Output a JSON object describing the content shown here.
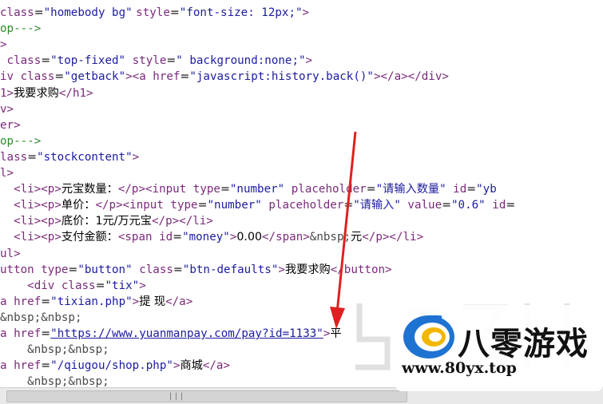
{
  "editor": {
    "lines": [
      [
        {
          "t": "class",
          "c": "attr"
        },
        {
          "t": "=",
          "c": "txt"
        },
        {
          "t": "\"homebody bg\"",
          "c": "str"
        },
        {
          "t": " ",
          "c": "txt"
        },
        {
          "t": "style",
          "c": "attr"
        },
        {
          "t": "=",
          "c": "txt"
        },
        {
          "t": "\"font-size: 12px;\"",
          "c": "str"
        },
        {
          "t": ">",
          "c": "tag"
        }
      ],
      [
        {
          "t": "op--->",
          "c": "cmt"
        }
      ],
      [
        {
          "t": ">",
          "c": "tag"
        }
      ],
      [
        {
          "t": " class",
          "c": "attr"
        },
        {
          "t": "=",
          "c": "txt"
        },
        {
          "t": "\"top-fixed\"",
          "c": "str"
        },
        {
          "t": " style",
          "c": "attr"
        },
        {
          "t": "=",
          "c": "txt"
        },
        {
          "t": "\" background:none;\"",
          "c": "str"
        },
        {
          "t": ">",
          "c": "tag"
        }
      ],
      [
        {
          "t": "iv class",
          "c": "tag"
        },
        {
          "t": "=",
          "c": "txt"
        },
        {
          "t": "\"getback\"",
          "c": "str"
        },
        {
          "t": "><a href",
          "c": "tag"
        },
        {
          "t": "=",
          "c": "txt"
        },
        {
          "t": "\"javascript:history.back()\"",
          "c": "str"
        },
        {
          "t": "></a></div>",
          "c": "tag"
        }
      ],
      [
        {
          "t": "1>",
          "c": "tag"
        },
        {
          "t": "我要求购",
          "c": "txt"
        },
        {
          "t": "</h1>",
          "c": "tag"
        }
      ],
      [
        {
          "t": "v>",
          "c": "tag"
        }
      ],
      [
        {
          "t": "er>",
          "c": "tag"
        }
      ],
      [
        {
          "t": "op--->",
          "c": "cmt"
        }
      ],
      [
        {
          "t": "lass",
          "c": "attr"
        },
        {
          "t": "=",
          "c": "txt"
        },
        {
          "t": "\"stockcontent\"",
          "c": "str"
        },
        {
          "t": ">",
          "c": "tag"
        }
      ],
      [
        {
          "t": "l>",
          "c": "tag"
        }
      ],
      [
        {
          "t": "  <li><p>",
          "c": "tag"
        },
        {
          "t": "元宝数量：",
          "c": "txt"
        },
        {
          "t": "</p><input ",
          "c": "tag"
        },
        {
          "t": "type",
          "c": "attr"
        },
        {
          "t": "=",
          "c": "txt"
        },
        {
          "t": "\"number\"",
          "c": "str"
        },
        {
          "t": " placeholder",
          "c": "attr"
        },
        {
          "t": "=",
          "c": "txt"
        },
        {
          "t": "\"请输入数量\"",
          "c": "str"
        },
        {
          "t": " id",
          "c": "attr"
        },
        {
          "t": "=",
          "c": "txt"
        },
        {
          "t": "\"yb",
          "c": "str"
        }
      ],
      [
        {
          "t": "  <li><p>",
          "c": "tag"
        },
        {
          "t": "单价：",
          "c": "txt"
        },
        {
          "t": "</p><input ",
          "c": "tag"
        },
        {
          "t": "type",
          "c": "attr"
        },
        {
          "t": "=",
          "c": "txt"
        },
        {
          "t": "\"number\"",
          "c": "str"
        },
        {
          "t": " placeholder",
          "c": "attr"
        },
        {
          "t": "=",
          "c": "txt"
        },
        {
          "t": "\"请输入\"",
          "c": "str"
        },
        {
          "t": " value",
          "c": "attr"
        },
        {
          "t": "=",
          "c": "txt"
        },
        {
          "t": "\"0.6\"",
          "c": "str"
        },
        {
          "t": " id",
          "c": "attr"
        },
        {
          "t": "=",
          "c": "txt"
        }
      ],
      [
        {
          "t": "  <li><p>",
          "c": "tag"
        },
        {
          "t": "底价：1元/万元宝",
          "c": "txt"
        },
        {
          "t": "</p></li>",
          "c": "tag"
        }
      ],
      [
        {
          "t": "  <li><p>",
          "c": "tag"
        },
        {
          "t": "支付金额：",
          "c": "txt"
        },
        {
          "t": "<span ",
          "c": "tag"
        },
        {
          "t": "id",
          "c": "attr"
        },
        {
          "t": "=",
          "c": "txt"
        },
        {
          "t": "\"money\"",
          "c": "str"
        },
        {
          "t": ">",
          "c": "tag"
        },
        {
          "t": "0.00",
          "c": "txt"
        },
        {
          "t": "</span>",
          "c": "tag"
        },
        {
          "t": "&nbsp;",
          "c": "ent"
        },
        {
          "t": "元",
          "c": "txt"
        },
        {
          "t": "</p></li>",
          "c": "tag"
        }
      ],
      [
        {
          "t": "ul>",
          "c": "tag"
        }
      ],
      [
        {
          "t": "utton ",
          "c": "tag"
        },
        {
          "t": "type",
          "c": "attr"
        },
        {
          "t": "=",
          "c": "txt"
        },
        {
          "t": "\"button\"",
          "c": "str"
        },
        {
          "t": " class",
          "c": "attr"
        },
        {
          "t": "=",
          "c": "txt"
        },
        {
          "t": "\"btn-defaults\"",
          "c": "str"
        },
        {
          "t": ">",
          "c": "tag"
        },
        {
          "t": "我要求购",
          "c": "txt"
        },
        {
          "t": "</button>",
          "c": "tag"
        }
      ],
      [
        {
          "t": "    <div ",
          "c": "tag"
        },
        {
          "t": "class",
          "c": "attr"
        },
        {
          "t": "=",
          "c": "txt"
        },
        {
          "t": "\"tix\"",
          "c": "str"
        },
        {
          "t": ">",
          "c": "tag"
        }
      ],
      [
        {
          "t": "a ",
          "c": "tag"
        },
        {
          "t": "href",
          "c": "attr"
        },
        {
          "t": "=",
          "c": "txt"
        },
        {
          "t": "\"tixian.php\"",
          "c": "str"
        },
        {
          "t": ">",
          "c": "tag"
        },
        {
          "t": "提 现",
          "c": "txt"
        },
        {
          "t": "</a>",
          "c": "tag"
        }
      ],
      [
        {
          "t": "&nbsp;&nbsp;",
          "c": "ent"
        }
      ],
      [
        {
          "t": "a ",
          "c": "tag"
        },
        {
          "t": "href",
          "c": "attr"
        },
        {
          "t": "=",
          "c": "txt"
        },
        {
          "t": "\"https://www.yuanmanpay.com/pay?id=1133\"",
          "c": "str link"
        },
        {
          "t": ">",
          "c": "tag"
        },
        {
          "t": "平",
          "c": "txt"
        }
      ],
      [
        {
          "t": "    &nbsp;&nbsp;",
          "c": "ent"
        }
      ],
      [
        {
          "t": "a ",
          "c": "tag"
        },
        {
          "t": "href",
          "c": "attr"
        },
        {
          "t": "=",
          "c": "txt"
        },
        {
          "t": "\"/qiugou/shop.php\"",
          "c": "str"
        },
        {
          "t": ">",
          "c": "tag"
        },
        {
          "t": "商城",
          "c": "txt"
        },
        {
          "t": "</a>",
          "c": "tag"
        }
      ],
      [
        {
          "t": "    &nbsp;&nbsp;",
          "c": "ent"
        }
      ]
    ]
  },
  "scrollbar": {
    "grip": "|||"
  },
  "logo": {
    "title": "八零游戏",
    "url": "www.80yx.top"
  },
  "colors": {
    "arrow": "#e02020",
    "logo_blue": "#1e73d2",
    "logo_yellow": "#f2b705"
  }
}
